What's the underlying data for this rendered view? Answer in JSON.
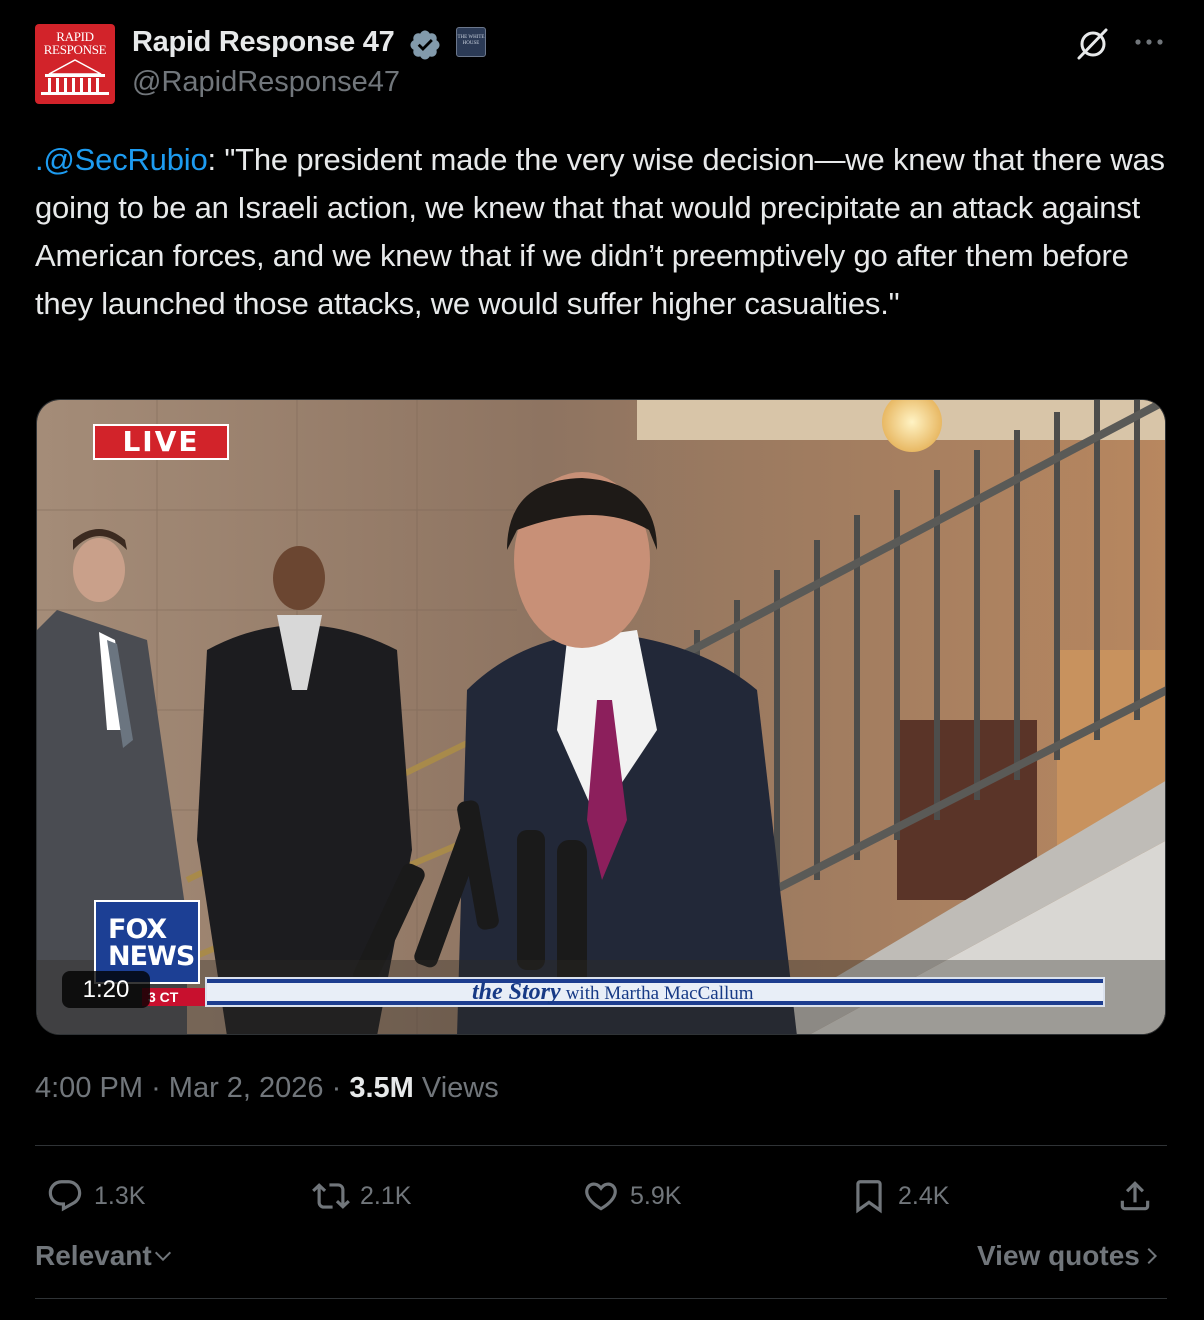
{
  "author": {
    "name": "Rapid Response 47",
    "handle": "@RapidResponse47",
    "avatar_text_line1": "RAPID",
    "avatar_text_line2": "RESPONSE",
    "affiliation_badge_text": "THE WHITE HOUSE"
  },
  "tweet": {
    "mention": ".@SecRubio",
    "text": ": \"The president made the very wise decision—we knew that there was going to be an Israeli action, we knew that that would precipitate an attack against American forces, and we knew that if we didn’t preemptively go after them before they launched those attacks, we would suffer higher casualties.\""
  },
  "media": {
    "live_label": "LIVE",
    "network_logo_line1": "FOX",
    "network_logo_line2": "NEWS",
    "time_zone_tag": "3 CT",
    "ticker_show": "the Story",
    "ticker_host": "with Martha MacCallum",
    "duration": "1:20"
  },
  "meta": {
    "time": "4:00 PM",
    "separator1": "·",
    "date": "Mar 2, 2026",
    "separator2": "·",
    "views_count": "3.5M",
    "views_label": "Views"
  },
  "actions": {
    "replies": "1.3K",
    "reposts": "2.1K",
    "likes": "5.9K",
    "bookmarks": "2.4K"
  },
  "footer": {
    "sort_label": "Relevant",
    "view_quotes_label": "View quotes"
  },
  "colors": {
    "background": "#000000",
    "text_primary": "#e7e9ea",
    "text_secondary": "#71767b",
    "link": "#1d9bf0",
    "divider": "#2f3336",
    "verified": "#829aab"
  },
  "icons": [
    "verified-badge-icon",
    "grok-icon",
    "more-icon",
    "reply-icon",
    "repost-icon",
    "like-icon",
    "bookmark-icon",
    "share-icon",
    "chevron-down-icon",
    "chevron-right-icon"
  ]
}
